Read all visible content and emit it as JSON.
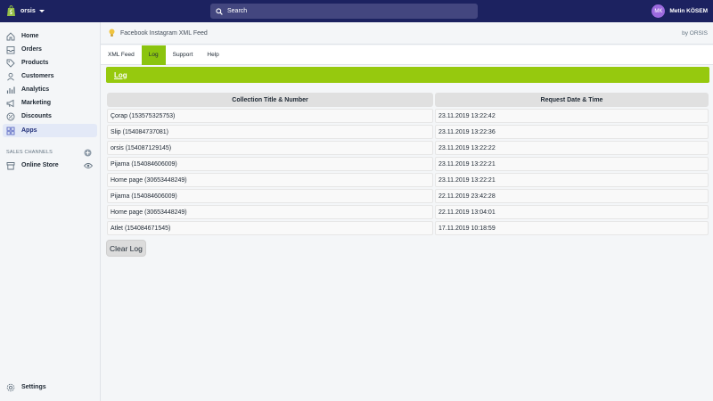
{
  "topbar": {
    "store_name": "orsis",
    "search_placeholder": "Search",
    "user_initials": "MK",
    "user_name": "Metin KÖSEM"
  },
  "sidebar": {
    "items": [
      {
        "label": "Home",
        "icon": "home-icon"
      },
      {
        "label": "Orders",
        "icon": "orders-icon"
      },
      {
        "label": "Products",
        "icon": "tag-icon"
      },
      {
        "label": "Customers",
        "icon": "person-icon"
      },
      {
        "label": "Analytics",
        "icon": "bar-chart-icon"
      },
      {
        "label": "Marketing",
        "icon": "megaphone-icon"
      },
      {
        "label": "Discounts",
        "icon": "discount-icon"
      },
      {
        "label": "Apps",
        "icon": "apps-icon",
        "active": true
      }
    ],
    "sales_channels_label": "SALES CHANNELS",
    "online_store_label": "Online Store",
    "settings_label": "Settings"
  },
  "app": {
    "title": "Facebook Instagram XML Feed",
    "by": "by ORSIS",
    "tabs": [
      "XML Feed",
      "Log",
      "Support",
      "Help"
    ],
    "active_tab": "Log",
    "section_link": "Log",
    "table": {
      "headers": [
        "Collection Title & Number",
        "Request Date & Time"
      ],
      "rows": [
        [
          "Çorap (153575325753)",
          "23.11.2019 13:22:42"
        ],
        [
          "Slip (154084737081)",
          "23.11.2019 13:22:36"
        ],
        [
          "orsis (154087129145)",
          "23.11.2019 13:22:22"
        ],
        [
          "Pijama (154084606009)",
          "23.11.2019 13:22:21"
        ],
        [
          "Home page (30653448249)",
          "23.11.2019 13:22:21"
        ],
        [
          "Pijama (154084606009)",
          "22.11.2019 23:42:28"
        ],
        [
          "Home page (30653448249)",
          "22.11.2019 13:04:01"
        ],
        [
          "Atlet (154084671545)",
          "17.11.2019 10:18:59"
        ]
      ]
    },
    "clear_button": "Clear Log"
  },
  "colors": {
    "topbar": "#1c2260",
    "accent_green": "#96c90e",
    "active_tab": "#8bc40e",
    "avatar": "#9c6ade"
  }
}
